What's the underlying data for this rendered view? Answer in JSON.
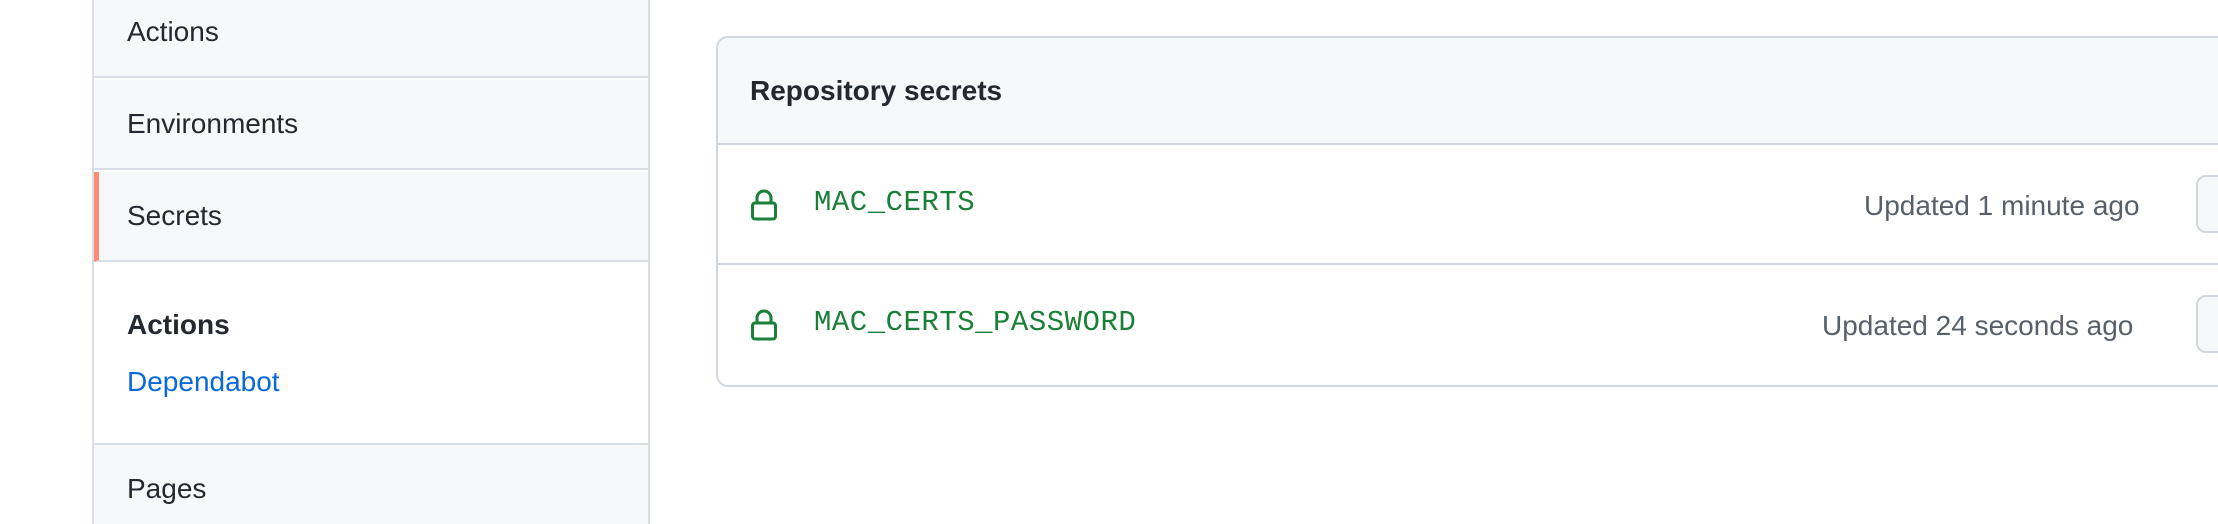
{
  "sidebar": {
    "items": [
      {
        "label": "Actions"
      },
      {
        "label": "Environments"
      },
      {
        "label": "Secrets",
        "selected": true
      }
    ],
    "group": {
      "heading": "Actions",
      "link": "Dependabot"
    },
    "after_group": {
      "label": "Pages"
    }
  },
  "secrets": {
    "title": "Repository secrets",
    "rows": [
      {
        "name": "MAC_CERTS",
        "updated": "Updated 1 minute ago"
      },
      {
        "name": "MAC_CERTS_PASSWORD",
        "updated": "Updated 24 seconds ago"
      }
    ]
  },
  "colors": {
    "selected_indicator": "#fd8c73",
    "secret_name": "#1a7f37",
    "link": "#0969da"
  }
}
